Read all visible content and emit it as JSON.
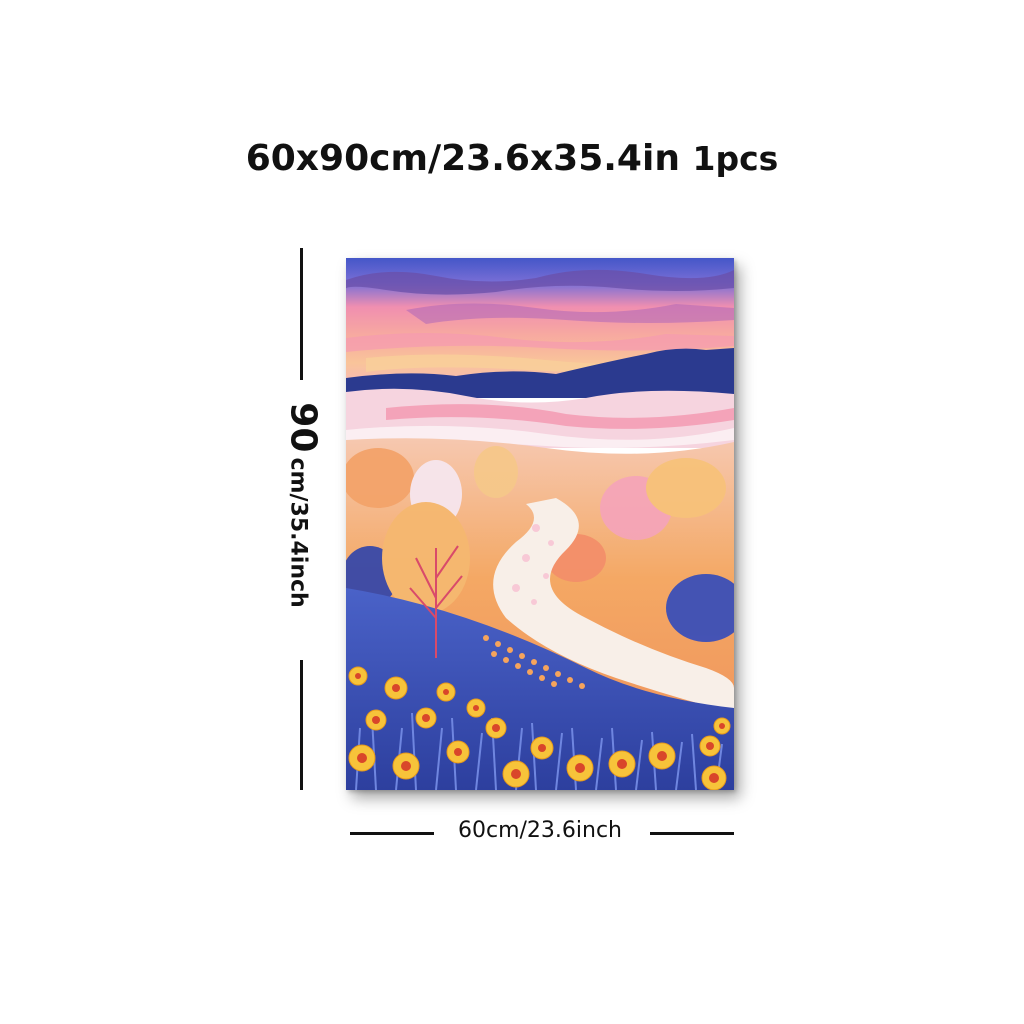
{
  "header": {
    "size_text": "60x90cm/23.6x35.4in",
    "quantity_text": "1pcs"
  },
  "dimensions": {
    "height_value": "90",
    "height_units": "cm/35.4inch",
    "width_label": "60cm/23.6inch"
  },
  "artwork": {
    "description_icon": "landscape-painting",
    "colors": {
      "sky_top": "#4a5fd0",
      "sky_pink": "#f59ab0",
      "sky_orange": "#f7b98a",
      "mountains": "#2b3a8f",
      "hills": "#f6d4df",
      "field_orange": "#f4a45c",
      "path": "#f8efe8",
      "grass_blue": "#3b4fb8",
      "flower_yellow": "#f7c33a",
      "flower_center": "#d9462a"
    }
  }
}
